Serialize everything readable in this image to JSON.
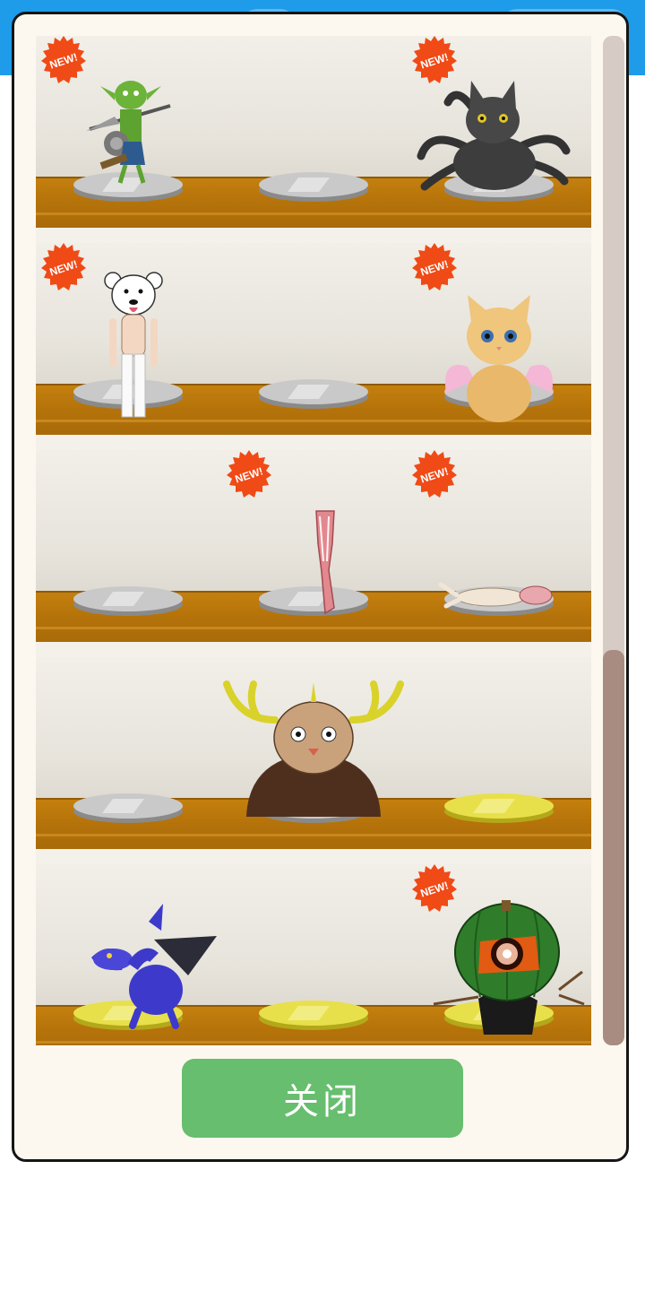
{
  "dialog": {
    "close_label": "关闭",
    "badge_label": "NEW!"
  },
  "colors": {
    "accent_green": "#66be6e",
    "shelf_wood": "#b5730a",
    "pedestal_silver": "#c8c8c8",
    "pedestal_gold": "#e8e04a",
    "badge_orange": "#f04a16"
  },
  "shelves": [
    {
      "slots": [
        {
          "creature": "goblin-warrior",
          "pedestal": "silver",
          "is_new": true
        },
        {
          "creature": "",
          "pedestal": "silver",
          "is_new": false
        },
        {
          "creature": "multi-tailed-black-cat",
          "pedestal": "silver",
          "is_new": true
        }
      ]
    },
    {
      "slots": [
        {
          "creature": "bear-masked-man",
          "pedestal": "silver",
          "is_new": true
        },
        {
          "creature": "",
          "pedestal": "silver",
          "is_new": false
        },
        {
          "creature": "winged-kitten",
          "pedestal": "silver",
          "is_new": true
        }
      ]
    },
    {
      "slots": [
        {
          "creature": "",
          "pedestal": "silver",
          "is_new": false
        },
        {
          "creature": "muscle-leg",
          "pedestal": "silver",
          "is_new": true
        },
        {
          "creature": "flayed-rabbit",
          "pedestal": "silver",
          "is_new": true
        }
      ]
    },
    {
      "slots": [
        {
          "creature": "",
          "pedestal": "silver",
          "is_new": false
        },
        {
          "creature": "antlered-beast",
          "pedestal": "silver",
          "is_new": false
        },
        {
          "creature": "",
          "pedestal": "gold",
          "is_new": false
        }
      ]
    },
    {
      "slots": [
        {
          "creature": "blue-dragon",
          "pedestal": "gold",
          "is_new": false
        },
        {
          "creature": "",
          "pedestal": "gold",
          "is_new": false
        },
        {
          "creature": "pumpkin-monster",
          "pedestal": "gold",
          "is_new": true
        }
      ]
    }
  ]
}
